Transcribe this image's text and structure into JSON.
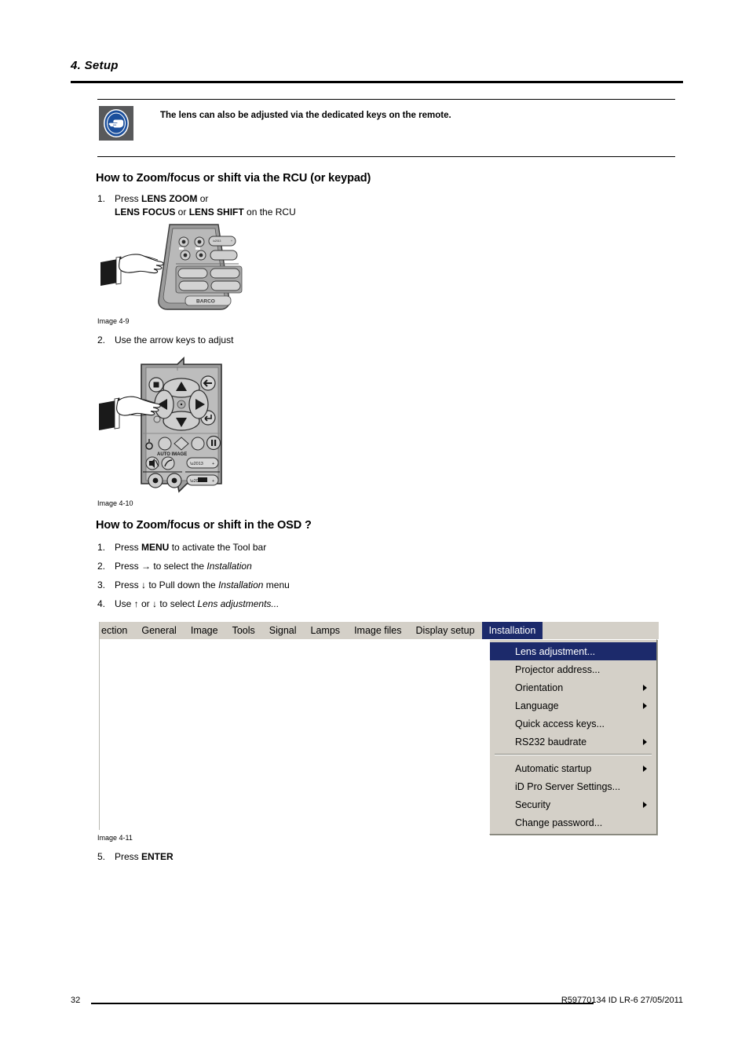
{
  "page": {
    "chapter_title": "4.  Setup",
    "page_number": "32",
    "doc_reference": "R59770134  ID LR-6  27/05/2011"
  },
  "note": {
    "icon": "pointing-hand-icon",
    "text": "The lens can also be adjusted via the dedicated keys on the remote.",
    "icon_bg_color": "#58595b",
    "icon_circle_color": "#1b4f9c"
  },
  "sections": [
    {
      "heading": "How to Zoom/focus or shift via the RCU (or keypad)",
      "steps": [
        {
          "num": "1.",
          "line1_pre": "Press ",
          "line1_bold": "LENS ZOOM",
          "line1_post": " or",
          "line2_bold1": "LENS FOCUS",
          "line2_mid": " or ",
          "line2_bold2": "LENS SHIFT",
          "line2_post": " on the RCU"
        },
        {
          "num": "2.",
          "text": "Use the arrow keys to adjust"
        }
      ],
      "figures": [
        {
          "caption": "Image 4-9",
          "alt": "rcu-keypad-illustration"
        },
        {
          "caption": "Image 4-10",
          "alt": "rcu-arrow-keys-illustration"
        }
      ]
    },
    {
      "heading": "How to Zoom/focus or shift in the OSD ?",
      "steps": [
        {
          "num": "1.",
          "pre": "Press ",
          "bold": "MENU",
          "post": " to activate the Tool bar"
        },
        {
          "num": "2.",
          "pre": "Press → to select the ",
          "italic": "Installation",
          "post": ""
        },
        {
          "num": "3.",
          "pre": "Press ↓ to Pull down the ",
          "italic": "Installation",
          "post": " menu"
        },
        {
          "num": "4.",
          "pre": "Use ↑ or ↓ to select ",
          "italic": "Lens adjustments...",
          "post": ""
        },
        {
          "num": "5.",
          "pre": "Press ",
          "bold": "ENTER",
          "post": ""
        }
      ],
      "figures": [
        {
          "caption": "Image 4-11",
          "alt": "osd-installation-menu"
        }
      ]
    }
  ],
  "osd": {
    "menubar": {
      "items": [
        {
          "label": "ection",
          "selected": false,
          "truncated": true
        },
        {
          "label": "General",
          "selected": false
        },
        {
          "label": "Image",
          "selected": false
        },
        {
          "label": "Tools",
          "selected": false
        },
        {
          "label": "Signal",
          "selected": false
        },
        {
          "label": "Lamps",
          "selected": false
        },
        {
          "label": "Image files",
          "selected": false
        },
        {
          "label": "Display setup",
          "selected": false
        },
        {
          "label": "Installation",
          "selected": true
        }
      ],
      "bg_color": "#d4d0c8",
      "selected_color": "#1c2a6b"
    },
    "dropdown": {
      "items": [
        {
          "label": "Lens adjustment...",
          "submenu": false,
          "highlight": true
        },
        {
          "label": "Projector address...",
          "submenu": false,
          "highlight": false
        },
        {
          "label": "Orientation",
          "submenu": true,
          "highlight": false
        },
        {
          "label": "Language",
          "submenu": true,
          "highlight": false
        },
        {
          "label": "Quick access keys...",
          "submenu": false,
          "highlight": false
        },
        {
          "label": "RS232 baudrate",
          "submenu": true,
          "highlight": false
        },
        {
          "separator": true
        },
        {
          "label": "Automatic startup",
          "submenu": true,
          "highlight": false
        },
        {
          "label": "iD Pro Server Settings...",
          "submenu": false,
          "highlight": false
        },
        {
          "label": "Security",
          "submenu": true,
          "highlight": false
        },
        {
          "label": "Change password...",
          "submenu": false,
          "highlight": false
        }
      ]
    }
  }
}
